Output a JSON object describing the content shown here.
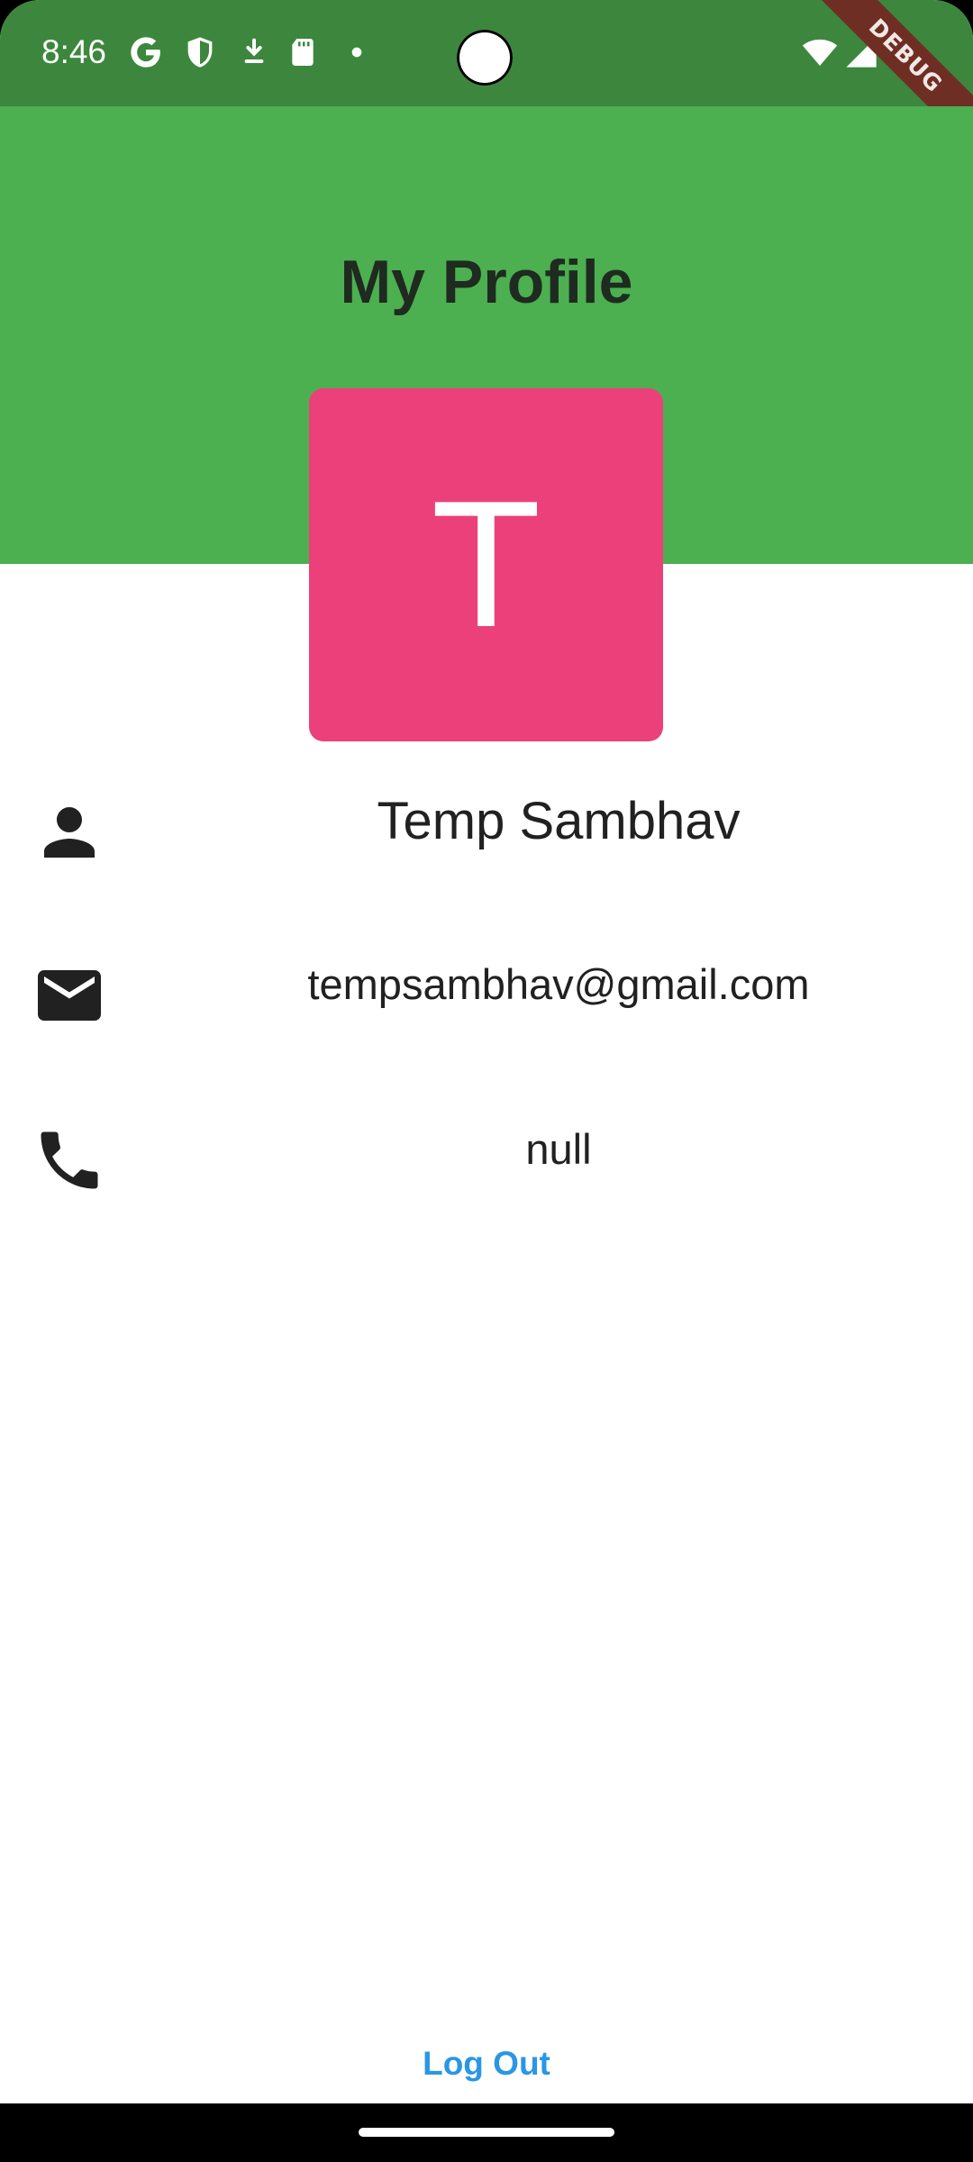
{
  "status_bar": {
    "time": "8:46",
    "left_icons": [
      "google-icon",
      "shield-icon",
      "download-icon",
      "sd-card-icon",
      "dot-icon"
    ],
    "right_icons": [
      "wifi-icon",
      "signal-icon",
      "battery-icon"
    ],
    "debug_banner": "DEBUG",
    "background_color": "#3c873d"
  },
  "header": {
    "title": "My Profile",
    "background_color": "#4caf50"
  },
  "avatar": {
    "initial": "T",
    "background_color": "#ec407a"
  },
  "profile": {
    "name": "Temp Sambhav",
    "email": "tempsambhav@gmail.com",
    "phone": "null"
  },
  "actions": {
    "logout_label": "Log Out",
    "accent_color": "#2a96e6"
  }
}
